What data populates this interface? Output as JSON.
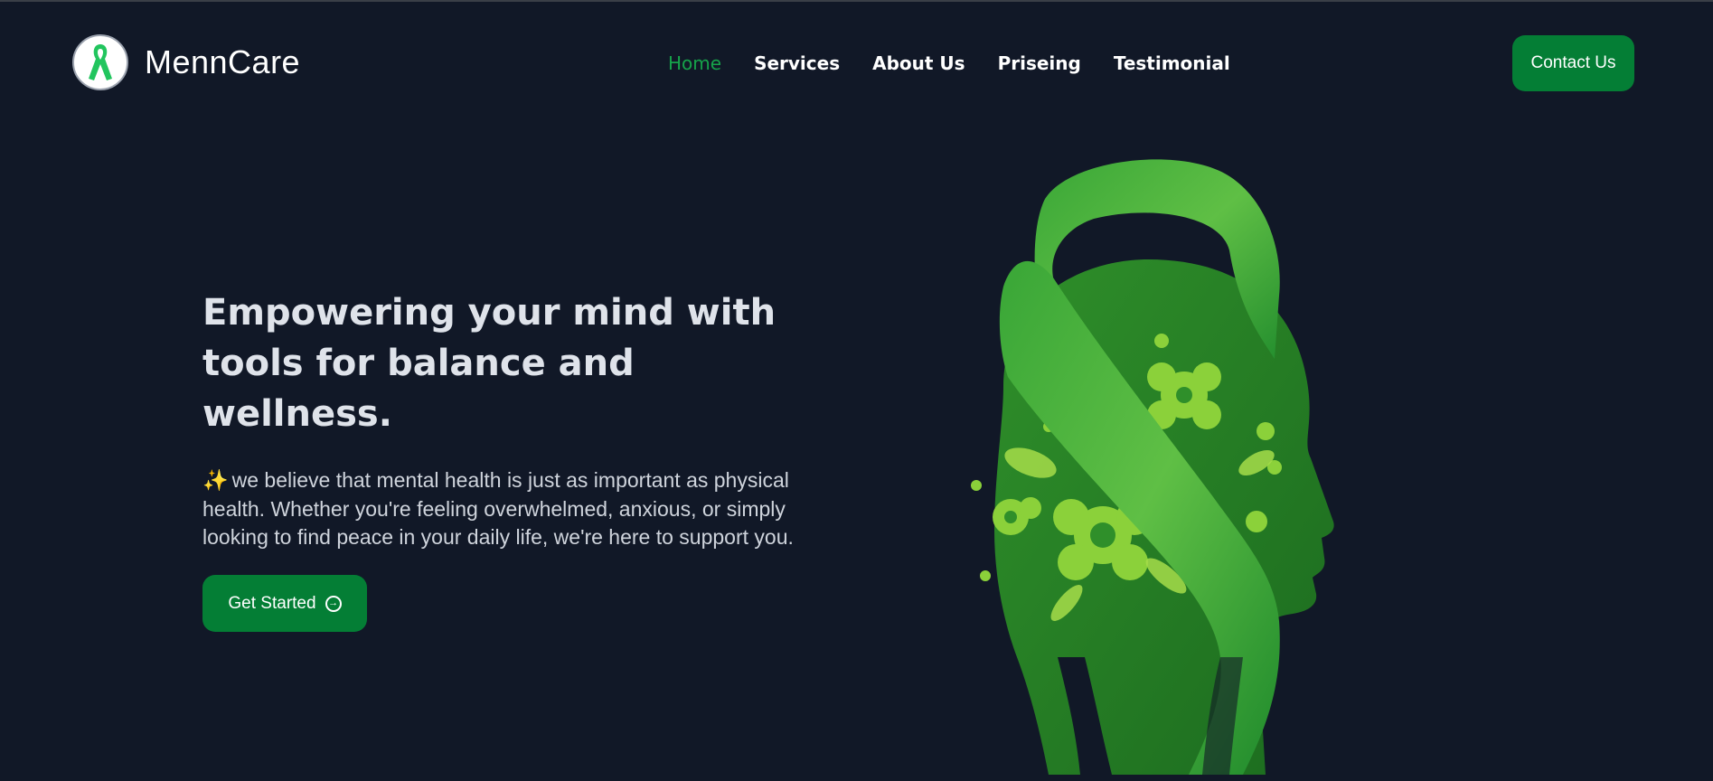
{
  "brand": {
    "name": "MennCare",
    "logo_icon": "awareness-ribbon-icon"
  },
  "nav": {
    "items": [
      {
        "label": "Home",
        "active": true
      },
      {
        "label": "Services",
        "active": false
      },
      {
        "label": "About Us",
        "active": false
      },
      {
        "label": "Priseing",
        "active": false
      },
      {
        "label": "Testimonial",
        "active": false
      }
    ],
    "contact_label": "Contact Us"
  },
  "hero": {
    "headline": "Empowering your mind with tools for balance and wellness.",
    "sparkle": "✨",
    "description": "we believe that mental health is just as important as physical health. Whether you're feeling overwhelmed, anxious, or simply looking to find peace in your daily life, we're here to support you.",
    "cta_label": "Get Started",
    "cta_icon": "arrow-right-circle-icon",
    "illustration": "head-with-ribbon-and-flowers-illustration"
  },
  "colors": {
    "background": "#111827",
    "accent": "#047e35",
    "active_link": "#16a34a"
  }
}
